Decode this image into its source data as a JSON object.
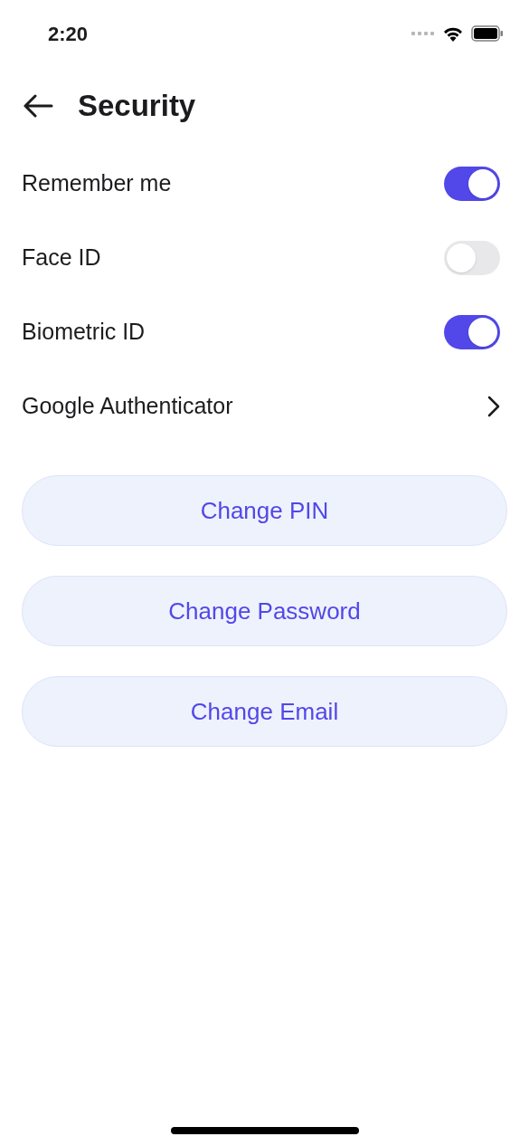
{
  "status_bar": {
    "time": "2:20"
  },
  "header": {
    "title": "Security"
  },
  "settings": [
    {
      "kind": "toggle",
      "label": "Remember me",
      "on": true
    },
    {
      "kind": "toggle",
      "label": "Face ID",
      "on": false
    },
    {
      "kind": "toggle",
      "label": "Biometric ID",
      "on": true
    },
    {
      "kind": "link",
      "label": "Google Authenticator"
    }
  ],
  "buttons": [
    "Change PIN",
    "Change Password",
    "Change Email"
  ]
}
